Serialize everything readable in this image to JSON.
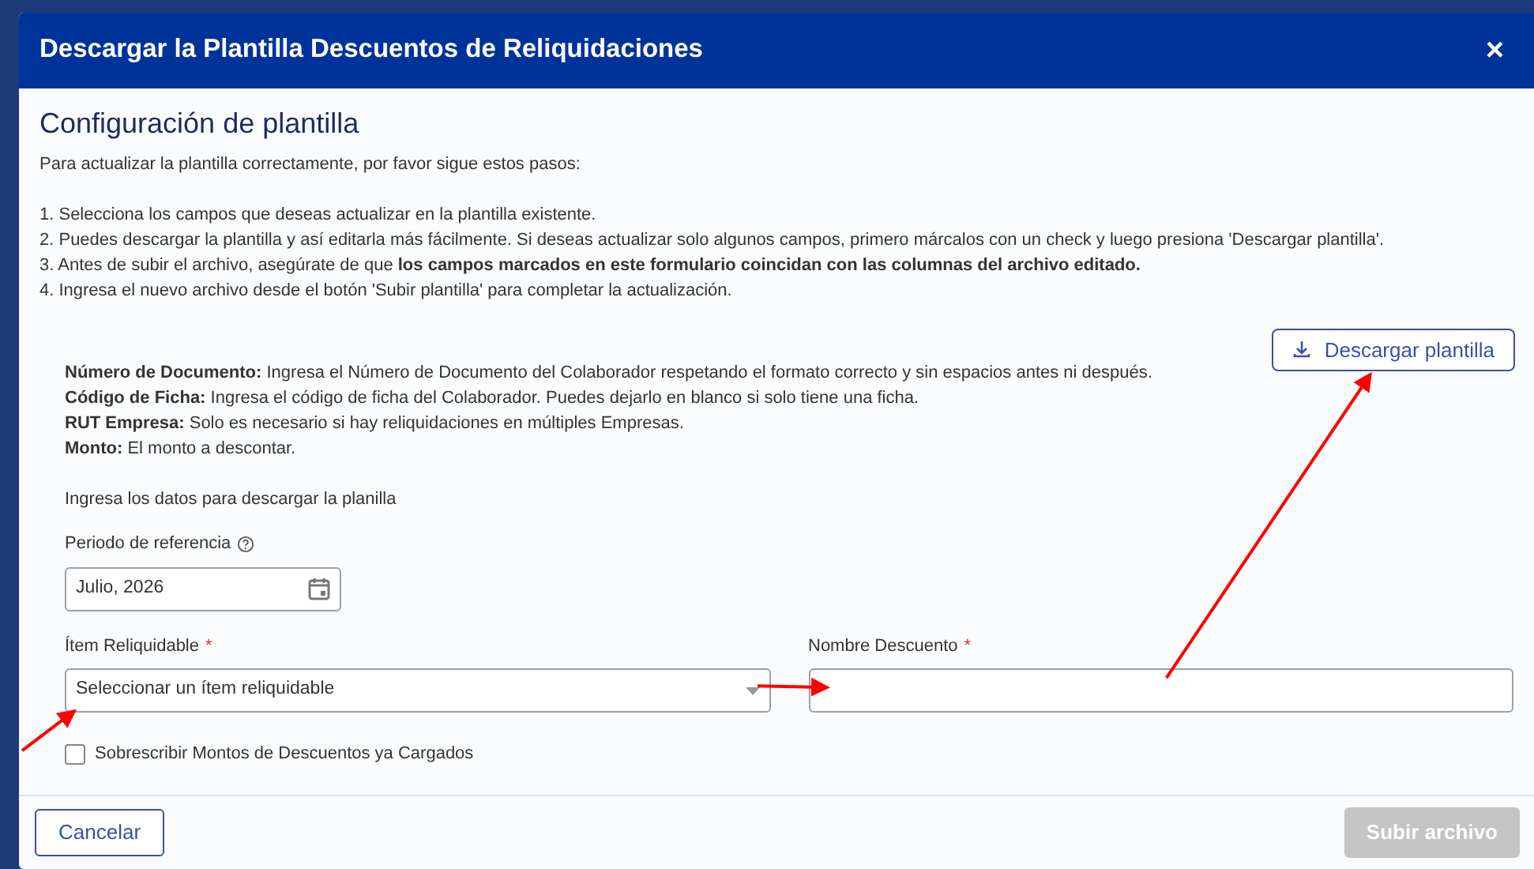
{
  "modal": {
    "title": "Descargar la Plantilla Descuentos de Reliquidaciones",
    "close": "×"
  },
  "section_title": "Configuración de plantilla",
  "intro": "Para actualizar la plantilla correctamente, por favor sigue estos pasos:",
  "steps": [
    "1. Selecciona los campos que deseas actualizar en la plantilla existente.",
    "2. Puedes descargar la plantilla y así editarla más fácilmente. Si deseas actualizar solo algunos campos, primero márcalos con un check y luego presiona 'Descargar plantilla'.",
    "3. Antes de subir el archivo, asegúrate de que **los campos marcados en este formulario coincidan con las columnas del archivo editado.**",
    "4. Ingresa el nuevo archivo desde el botón 'Subir plantilla' para completar la actualización."
  ],
  "download_button": {
    "label": "Descargar plantilla"
  },
  "field_notes": [
    "**Número de Documento:** Ingresa el Número de Documento del Colaborador respetando el formato correcto y sin espacios antes ni después.",
    "**Código de Ficha:** Ingresa el código de ficha del Colaborador. Puedes dejarlo en blanco si solo tiene una ficha.",
    "**RUT Empresa:** Solo es necesario si hay reliquidaciones en múltiples Empresas.",
    "**Monto:** El monto a descontar."
  ],
  "form_hint": "Ingresa los datos para descargar la planilla",
  "period": {
    "label": "Periodo de referencia",
    "value": "Julio, 2026"
  },
  "item_select": {
    "label": "Ítem Reliquidable",
    "required_mark": "*",
    "placeholder": "Seleccionar un ítem reliquidable"
  },
  "discount_name": {
    "label": "Nombre Descuento",
    "required_mark": "*"
  },
  "overwrite": {
    "label": "Sobrescribir Montos de Descuentos ya Cargados",
    "checked": false
  },
  "footer": {
    "cancel": "Cancelar",
    "submit": "Subir archivo",
    "submit_disabled": true
  },
  "annotation_arrows": [
    {
      "kind": "arrow"
    },
    {
      "kind": "arrow"
    },
    {
      "kind": "arrow"
    }
  ]
}
